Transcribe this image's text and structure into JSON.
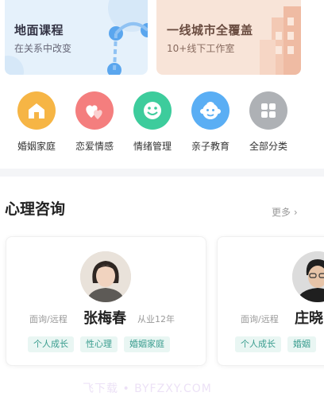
{
  "banners": [
    {
      "title": "地面课程",
      "subtitle": "在关系中改变"
    },
    {
      "title": "一线城市全覆盖",
      "subtitle": "10+线下工作室"
    }
  ],
  "categories": [
    {
      "label": "婚姻家庭",
      "icon": "house-icon",
      "color": "#f6b545"
    },
    {
      "label": "恋爱情感",
      "icon": "hearts-icon",
      "color": "#f47e7e"
    },
    {
      "label": "情绪管理",
      "icon": "smile-icon",
      "color": "#3dcc9c"
    },
    {
      "label": "亲子教育",
      "icon": "child-face-icon",
      "color": "#5aaef4"
    },
    {
      "label": "全部分类",
      "icon": "grid-icon",
      "color": "#aeb1b5"
    }
  ],
  "consult": {
    "title": "心理咨询",
    "more": "更多 ›",
    "counselors": [
      {
        "mode": "面询/远程",
        "name": "张梅春",
        "years": "从业12年",
        "tags": [
          "个人成长",
          "性心理",
          "婚姻家庭"
        ]
      },
      {
        "mode": "面询/远程",
        "name": "庄晓",
        "tags": [
          "个人成长",
          "婚姻"
        ]
      }
    ]
  },
  "watermark": "飞下载 • BYFZXY.COM"
}
